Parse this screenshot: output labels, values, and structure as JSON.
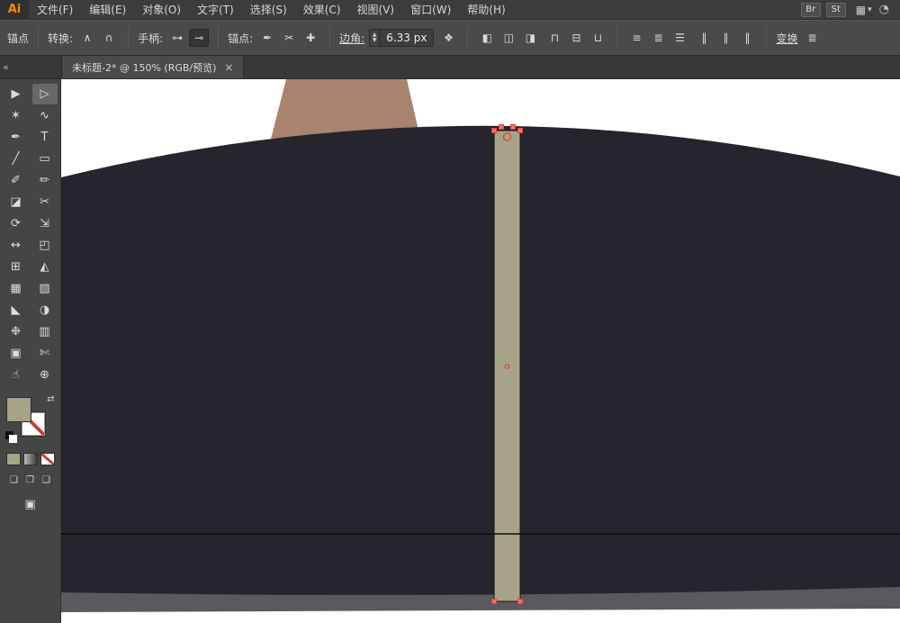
{
  "menubar": {
    "logo": "Ai",
    "items": [
      {
        "name": "menu-file",
        "label": "文件(F)"
      },
      {
        "name": "menu-edit",
        "label": "编辑(E)"
      },
      {
        "name": "menu-object",
        "label": "对象(O)"
      },
      {
        "name": "menu-type",
        "label": "文字(T)"
      },
      {
        "name": "menu-select",
        "label": "选择(S)"
      },
      {
        "name": "menu-effect",
        "label": "效果(C)"
      },
      {
        "name": "menu-view",
        "label": "视图(V)"
      },
      {
        "name": "menu-window",
        "label": "窗口(W)"
      },
      {
        "name": "menu-help",
        "label": "帮助(H)"
      }
    ],
    "badges": [
      "Br",
      "St"
    ],
    "workspace_icon": "▦",
    "chevron": "▾",
    "sync_icon": "◔"
  },
  "controlbar": {
    "context": "锚点",
    "convert_label": "转换:",
    "convert_icons": [
      {
        "name": "convert-to-corner-icon",
        "glyph": "∧"
      },
      {
        "name": "convert-to-smooth-icon",
        "glyph": "∩"
      }
    ],
    "handles_label": "手柄:",
    "handles_icons": [
      {
        "name": "show-handles-icon",
        "glyph": "⊶"
      },
      {
        "name": "hide-handles-icon",
        "glyph": "⊸",
        "active": true
      }
    ],
    "anchors_label": "锚点:",
    "anchors_icons": [
      {
        "name": "remove-anchor-icon",
        "glyph": "✒"
      },
      {
        "name": "cut-path-icon",
        "glyph": "✂"
      },
      {
        "name": "connect-path-icon",
        "glyph": "✚"
      }
    ],
    "corner_label": "边角:",
    "corner_value": "6.33 px",
    "corner_options_icon": "❖",
    "align_h_icons": [
      {
        "name": "align-left-icon",
        "glyph": "◧"
      },
      {
        "name": "align-h-center-icon",
        "glyph": "◫"
      },
      {
        "name": "align-right-icon",
        "glyph": "◨"
      }
    ],
    "align_v_icons": [
      {
        "name": "align-top-icon",
        "glyph": "⊓"
      },
      {
        "name": "align-v-center-icon",
        "glyph": "⊟"
      },
      {
        "name": "align-bottom-icon",
        "glyph": "⊔"
      }
    ],
    "distribute_v_icons": [
      {
        "name": "distribute-top-icon",
        "glyph": "≡"
      },
      {
        "name": "distribute-v-center-icon",
        "glyph": "≣"
      },
      {
        "name": "distribute-bottom-icon",
        "glyph": "☰"
      }
    ],
    "distribute_h_icons": [
      {
        "name": "distribute-left-icon",
        "glyph": "‖"
      },
      {
        "name": "distribute-h-center-icon",
        "glyph": "∥"
      },
      {
        "name": "distribute-right-icon",
        "glyph": "‖"
      }
    ],
    "transform_label": "变换",
    "menu_icon": "≣"
  },
  "tab": {
    "collapse": "«",
    "title": "未标题-2* @ 150% (RGB/预览)",
    "close": "×"
  },
  "tools": [
    {
      "name": "selection-tool",
      "glyph": "▶"
    },
    {
      "name": "direct-selection-tool",
      "glyph": "▷",
      "active": true
    },
    {
      "name": "magic-wand-tool",
      "glyph": "✶"
    },
    {
      "name": "lasso-tool",
      "glyph": "∿"
    },
    {
      "name": "pen-tool",
      "glyph": "✒"
    },
    {
      "name": "type-tool",
      "glyph": "T"
    },
    {
      "name": "line-segment-tool",
      "glyph": "╱"
    },
    {
      "name": "rectangle-tool",
      "glyph": "▭"
    },
    {
      "name": "paintbrush-tool",
      "glyph": "✐"
    },
    {
      "name": "pencil-tool",
      "glyph": "✏"
    },
    {
      "name": "eraser-tool",
      "glyph": "◪"
    },
    {
      "name": "scissors-tool",
      "glyph": "✂"
    },
    {
      "name": "rotate-tool",
      "glyph": "⟳"
    },
    {
      "name": "scale-tool",
      "glyph": "⇲"
    },
    {
      "name": "width-tool",
      "glyph": "↔"
    },
    {
      "name": "free-transform-tool",
      "glyph": "◰"
    },
    {
      "name": "shape-builder-tool",
      "glyph": "⊞"
    },
    {
      "name": "perspective-grid-tool",
      "glyph": "◭"
    },
    {
      "name": "mesh-tool",
      "glyph": "▦"
    },
    {
      "name": "gradient-tool",
      "glyph": "▧"
    },
    {
      "name": "eyedropper-tool",
      "glyph": "◣"
    },
    {
      "name": "blend-tool",
      "glyph": "◑"
    },
    {
      "name": "symbol-sprayer-tool",
      "glyph": "❉"
    },
    {
      "name": "column-graph-tool",
      "glyph": "▥"
    },
    {
      "name": "artboard-tool",
      "glyph": "▣"
    },
    {
      "name": "slice-tool",
      "glyph": "✄"
    },
    {
      "name": "hand-tool",
      "glyph": "☝"
    },
    {
      "name": "zoom-tool",
      "glyph": "⊕"
    }
  ],
  "toolspanel": {
    "swap_icon": "⇄",
    "draw_modes": [
      {
        "name": "draw-normal-mode-button",
        "glyph": "❏"
      },
      {
        "name": "draw-behind-mode-button",
        "glyph": "❐"
      },
      {
        "name": "draw-inside-mode-button",
        "glyph": "❑"
      }
    ],
    "screen_mode_icon": "▣"
  },
  "colors": {
    "fill_olive": "#a7a388",
    "coat": "#25252d",
    "neck": "#a8846f",
    "ground": "#5a5a5e",
    "seam": "#0c0c10",
    "handle_fill": "#fa6e66",
    "handle_stroke": "#e1423b"
  }
}
